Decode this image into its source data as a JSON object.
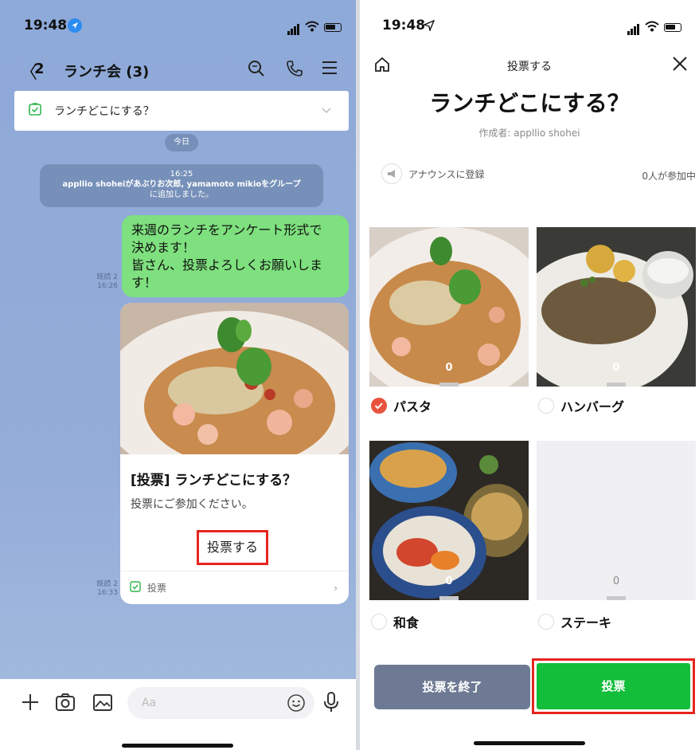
{
  "left": {
    "status_time": "19:48",
    "header": {
      "back": "〈",
      "count": "2",
      "title": "ランチ会 (3)"
    },
    "pinned": {
      "text": "ランチどこにする？"
    },
    "date_chip": "今日",
    "system_message": {
      "time": "16:25",
      "line1": "appllio shoheiがあぶりお次郎, yamamoto mikioをグループ",
      "line2": "に追加しました。"
    },
    "message": {
      "text_lines": [
        "来週のランチをアンケート形式で",
        "決めます！",
        "皆さん、投票よろしくお願いしま",
        "す！"
      ],
      "read": "既読 2",
      "time": "16:26"
    },
    "card": {
      "title": "[投票] ランチどこにする？",
      "subtitle": "投票にご参加ください。",
      "button": "投票する",
      "footer": "投票",
      "footer_arrow": "›",
      "read": "既読 2",
      "time": "16:33"
    },
    "input": {
      "placeholder": "Aa"
    }
  },
  "right": {
    "status_time": "19:48",
    "header_title": "投票する",
    "poll_title": "ランチどこにする？",
    "author": "作成者: appllio shohei",
    "announce": "アナウンスに登録",
    "participants": "0人が参加中",
    "options": [
      {
        "label": "パスタ",
        "count": "0",
        "selected": true
      },
      {
        "label": "ハンバーグ",
        "count": "0",
        "selected": false
      },
      {
        "label": "和食",
        "count": "0",
        "selected": false
      },
      {
        "label": "ステーキ",
        "count": "0",
        "selected": false
      }
    ],
    "end_button": "投票を終了",
    "vote_button": "投票"
  },
  "colors": {
    "chat_bg": "#93acd8",
    "bubble_green": "#7ee07e",
    "vote_green": "#12be3a",
    "highlight_red": "#e6251f",
    "end_gray": "#6e7a93",
    "selected_radio": "#e8533e"
  }
}
